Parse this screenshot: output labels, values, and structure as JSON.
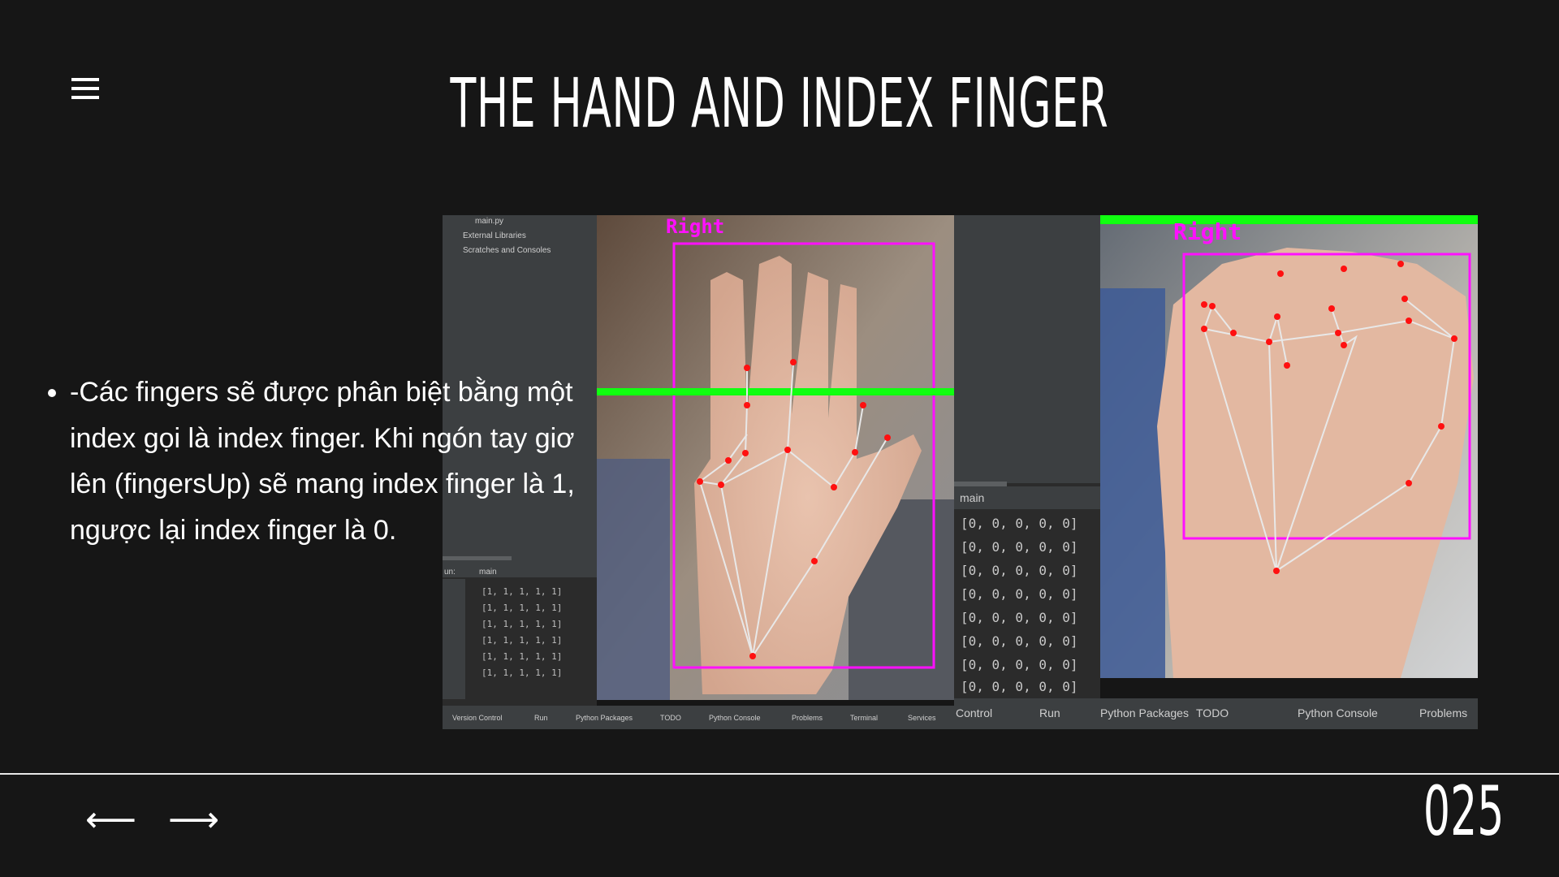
{
  "slide": {
    "title": "THE HAND AND INDEX FINGER",
    "bullet": "-Các fingers sẽ được phân biệt bằng một index gọi là index finger. Khi ngón tay giơ lên (fingersUp) sẽ mang index finger là 1, ngược lại index finger là 0.",
    "page_number": "025",
    "prev_arrow": "⟵",
    "next_arrow": "⟶"
  },
  "ide_left": {
    "project_items": [
      "main.py",
      "External Libraries",
      "Scratches and Consoles"
    ],
    "run_tab_prefix": "un:",
    "run_tab": "main",
    "console_lines": [
      "[1, 1, 1, 1, 1]",
      "[1, 1, 1, 1, 1]",
      "[1, 1, 1, 1, 1]",
      "[1, 1, 1, 1, 1]",
      "[1, 1, 1, 1, 1]",
      "[1, 1, 1, 1, 1]"
    ],
    "status_items": [
      "Version Control",
      "Run",
      "Python Packages",
      "TODO",
      "Python Console",
      "Problems",
      "Terminal",
      "Services"
    ],
    "hand_label": "Right"
  },
  "ide_right": {
    "run_tab": "main",
    "console_lines": [
      "[0, 0, 0, 0, 0]",
      "[0, 0, 0, 0, 0]",
      "[0, 0, 0, 0, 0]",
      "[0, 0, 0, 0, 0]",
      "[0, 0, 0, 0, 0]",
      "[0, 0, 0, 0, 0]",
      "[0, 0, 0, 0, 0]",
      "[0, 0, 0, 0, 0]"
    ],
    "status_items": [
      "Control",
      "Run",
      "Python Packages",
      "TODO",
      "Python Console",
      "Problems"
    ],
    "hand_label": "Right"
  },
  "colors": {
    "background": "#161616",
    "landmark": "#ff1010",
    "box": "#ff10ff",
    "line": "#10ff10",
    "ide_dark": "#2b2b2b"
  }
}
